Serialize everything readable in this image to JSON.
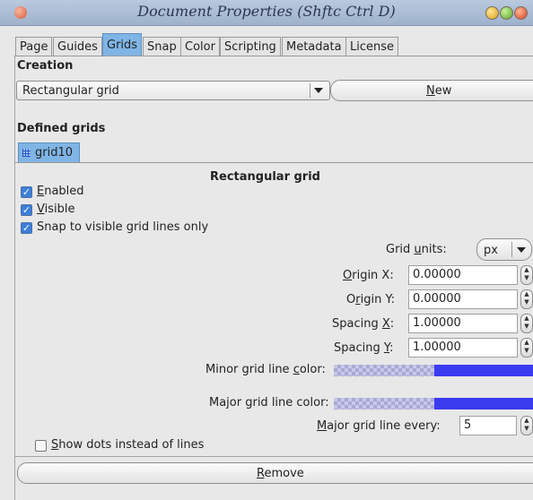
{
  "window": {
    "title": "Document Properties (Shftc Ctrl D)"
  },
  "tabs": [
    "Page",
    "Guides",
    "Grids",
    "Snap",
    "Color",
    "Scripting",
    "Metadata",
    "License"
  ],
  "active_tab": "Grids",
  "creation": {
    "heading": "Creation",
    "grid_type": "Rectangular grid",
    "new_button": {
      "mnemonic": "N",
      "rest": "ew"
    }
  },
  "defined_grids": {
    "heading": "Defined grids",
    "grid_tab_label": "grid10",
    "panel_title": "Rectangular grid"
  },
  "options": {
    "enabled": {
      "mnemonic": "E",
      "rest": "nabled",
      "checked": true
    },
    "visible": {
      "mnemonic": "V",
      "rest": "isible",
      "checked": true
    },
    "snap_visible": {
      "label": "Snap to visible grid lines only",
      "checked": true
    }
  },
  "grid_units": {
    "pre": "Grid ",
    "mnemonic": "u",
    "post": "nits:",
    "value": "px"
  },
  "fields": {
    "origin_x": {
      "pre": "",
      "mnemonic": "O",
      "post": "rigin X:",
      "value": "0.00000"
    },
    "origin_y": {
      "pre": "O",
      "mnemonic": "r",
      "post": "igin Y:",
      "value": "0.00000"
    },
    "spacing_x": {
      "pre": "Spacing ",
      "mnemonic": "X",
      "post": ":",
      "value": "1.00000"
    },
    "spacing_y": {
      "pre": "Spacing ",
      "mnemonic": "Y",
      "post": ":",
      "value": "1.00000"
    }
  },
  "minor_color": {
    "pre": "Minor grid line ",
    "mnemonic": "c",
    "post": "olor:",
    "swatch": "#3b3bf0"
  },
  "major_color": {
    "pre": "Major grid line color:",
    "swatch": "#3b3bf0"
  },
  "major_every": {
    "mnemonic": "M",
    "post": "ajor grid line every:",
    "value": "5"
  },
  "show_dots": {
    "mnemonic": "S",
    "rest": "how dots instead of lines",
    "checked": false
  },
  "remove_button": {
    "mnemonic": "R",
    "rest": "emove"
  }
}
